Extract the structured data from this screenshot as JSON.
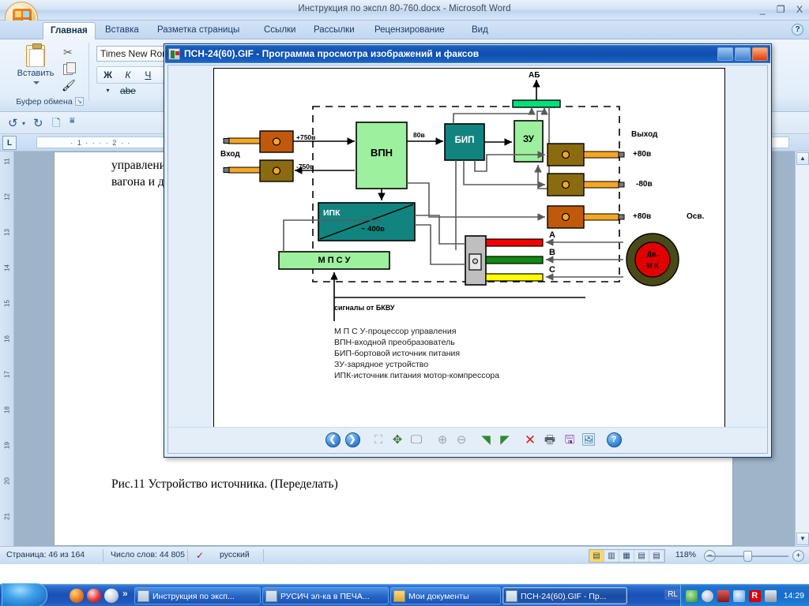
{
  "word": {
    "title": "Инструкция по экспл 80-760.docx - Microsoft Word",
    "window_buttons": {
      "minimize": "_",
      "restore": "❐",
      "close": "X"
    },
    "tabs": [
      {
        "label": "Главная",
        "active": true
      },
      {
        "label": "Вставка",
        "active": false
      },
      {
        "label": "Разметка страницы",
        "active": false
      },
      {
        "label": "Ссылки",
        "active": false
      },
      {
        "label": "Рассылки",
        "active": false
      },
      {
        "label": "Рецензирование",
        "active": false
      },
      {
        "label": "Вид",
        "active": false
      }
    ],
    "help_icon": "?",
    "ribbon": {
      "clipboard_group_label": "Буфер обмена",
      "paste_label": "Вставить",
      "font_name": "Times New Roman",
      "format_buttons": [
        "Ж",
        "К",
        "Ч",
        "▾",
        "abe"
      ]
    },
    "ruler": {
      "tab_selector": "L",
      "horizontal_marks": "· 1 · · · · 2 · ·",
      "vertical_numbers": [
        "11",
        "12",
        "13",
        "14",
        "15",
        "16",
        "17",
        "18",
        "19",
        "20",
        "21"
      ]
    },
    "document": {
      "line1": "управления и в",
      "line2": "вагона и двига",
      "caption": "Рис.11 Устройство источника. (Переделать)"
    },
    "statusbar": {
      "page": "Страница: 46 из 164",
      "words": "Число слов: 44 805",
      "language": "русский",
      "spell_icon": "spellcheck-icon",
      "zoom": "118%",
      "zoom_minus": "−",
      "zoom_plus": "+",
      "view_buttons": [
        "print-layout",
        "full-screen-read",
        "web-layout",
        "outline",
        "draft"
      ]
    }
  },
  "viewer": {
    "title": "ПСН-24(60).GIF - Программа просмотра изображений и факсов",
    "title_icon": "picture-fax-viewer-icon",
    "window_buttons": {
      "minimize": "minimize-icon",
      "maximize": "maximize-icon",
      "close": "close-icon"
    },
    "toolbar": [
      {
        "name": "previous-image-icon",
        "glyph": "❮"
      },
      {
        "name": "next-image-icon",
        "glyph": "❯"
      },
      {
        "name": "best-fit-icon",
        "glyph": "⛶"
      },
      {
        "name": "actual-size-icon",
        "glyph": "✥"
      },
      {
        "name": "slideshow-icon",
        "glyph": "🖵"
      },
      {
        "name": "zoom-in-icon",
        "glyph": "⊕"
      },
      {
        "name": "zoom-out-icon",
        "glyph": "⊖"
      },
      {
        "name": "rotate-clockwise-icon",
        "glyph": "◢"
      },
      {
        "name": "rotate-counterclockwise-icon",
        "glyph": "◣"
      },
      {
        "name": "delete-icon",
        "glyph": "✕"
      },
      {
        "name": "print-icon",
        "glyph": "🖶"
      },
      {
        "name": "save-as-icon",
        "glyph": "💾"
      },
      {
        "name": "edit-image-icon",
        "glyph": "✎"
      },
      {
        "name": "help-icon",
        "glyph": "?"
      }
    ]
  },
  "diagram": {
    "labels": {
      "ab": "АБ",
      "input": "Вход",
      "output": "Выход",
      "plus750": "+750в",
      "minus750": "-750в",
      "v80": "80в",
      "out_plus80_a": "+80в",
      "out_minus80": "-80в",
      "out_plus80_b": "+80в",
      "lighting": "Осв.",
      "ipk_ac": "~ 400в",
      "phase_a": "А",
      "phase_b": "В",
      "phase_c": "С",
      "signals": "сигналы от БКВУ"
    },
    "blocks": {
      "vpn": "ВПН",
      "bip": "БИП",
      "zu": "ЗУ",
      "ipk": "ИПК",
      "mpsu": "М П С У",
      "motor_line1": "Дв.",
      "motor_line2": "М К"
    },
    "legend": [
      "М П С У-процессор управления",
      "ВПН-входной преобразователь",
      "БИП-бортовой источник питания",
      "ЗУ-зарядное устройство",
      "ИПК-источник питания мотор-компрессора"
    ],
    "colors": {
      "green_block": "#9df09d",
      "teal_block": "#12847f",
      "bright_green": "#00e07a",
      "orange_connector": "#f5a623",
      "brown_connector": "#c05a0a",
      "dark_brown_connector": "#8a6b10",
      "wire_red": "#f50000",
      "wire_green": "#108a10",
      "wire_yellow": "#ffff00",
      "motor_red": "#e00000",
      "motor_ring": "#4a4a18"
    }
  },
  "taskbar": {
    "start_label": "start-orb",
    "quick_launch": [
      "firefox-icon",
      "opera-icon",
      "cd-icon"
    ],
    "quick_launch_more": "»",
    "tasks": [
      {
        "label": "Инструкция по эксп...",
        "icon": "word-doc-icon",
        "active": false
      },
      {
        "label": "РУСИЧ эл-ка в ПЕЧА...",
        "icon": "word-doc-icon",
        "active": false
      },
      {
        "label": "Мои документы",
        "icon": "folder-icon",
        "active": false
      },
      {
        "label": "ПСН-24(60).GIF - Пр...",
        "icon": "image-viewer-icon",
        "active": true
      }
    ],
    "language": "RL",
    "tray_icons": [
      "network-icon",
      "shield-icon",
      "monitor-icon",
      "volume-icon",
      "antivirus-icon",
      "printer-icon"
    ],
    "clock": "14:29"
  }
}
